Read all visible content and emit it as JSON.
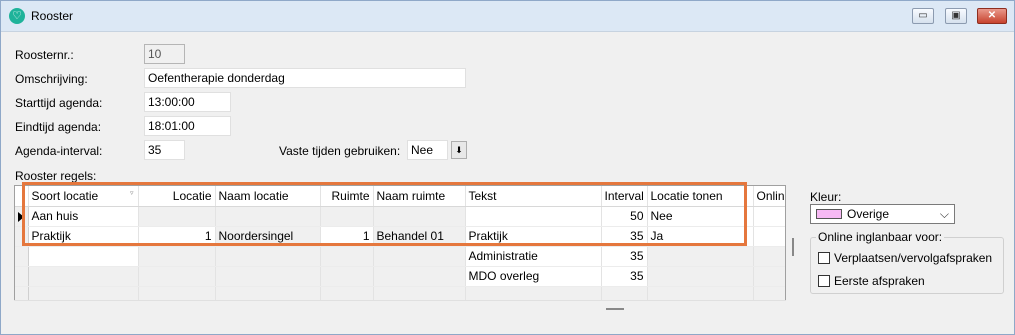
{
  "window": {
    "title": "Rooster",
    "min_label": "▭",
    "max_label": "▣",
    "close_label": "✕"
  },
  "form": {
    "roosternr": {
      "label": "Roosternr.:",
      "value": "10"
    },
    "omschrijving": {
      "label": "Omschrijving:",
      "value": "Oefentherapie donderdag"
    },
    "starttijd": {
      "label": "Starttijd agenda:",
      "value": "13:00:00"
    },
    "eindtijd": {
      "label": "Eindtijd agenda:",
      "value": "18:01:00"
    },
    "interval": {
      "label": "Agenda-interval:",
      "value": "35"
    },
    "vaste_tijden": {
      "label": "Vaste tijden gebruiken:",
      "value": "Nee"
    }
  },
  "grid": {
    "label": "Rooster regels:",
    "columns": [
      "Soort locatie",
      "Locatie",
      "Naam locatie",
      "Ruimte",
      "Naam ruimte",
      "Tekst",
      "Interval",
      "Locatie tonen",
      "Online"
    ],
    "rows": [
      [
        "Aan huis",
        "",
        "",
        "",
        "",
        "",
        "50",
        "Nee",
        ""
      ],
      [
        "Praktijk",
        "1",
        "Noordersingel",
        "1",
        "Behandel 01",
        "Praktijk",
        "35",
        "Ja",
        ""
      ],
      [
        "",
        "",
        "",
        "",
        "",
        "Administratie",
        "35",
        "",
        ""
      ],
      [
        "",
        "",
        "",
        "",
        "",
        "MDO overleg",
        "35",
        "",
        ""
      ],
      [
        "",
        "",
        "",
        "",
        "",
        "",
        "",
        "",
        ""
      ]
    ]
  },
  "kleur": {
    "label": "Kleur:",
    "value": "Overige",
    "swatch_color": "#f7b9f4"
  },
  "online": {
    "title": "Online inglanbaar voor:",
    "options": [
      {
        "label": "Verplaatsen/vervolgafspraken",
        "checked": false
      },
      {
        "label": "Eerste afspraken",
        "checked": false
      }
    ]
  },
  "accent_colors": {
    "highlight": "#e5773d",
    "titlebar": "#dce8f5"
  }
}
